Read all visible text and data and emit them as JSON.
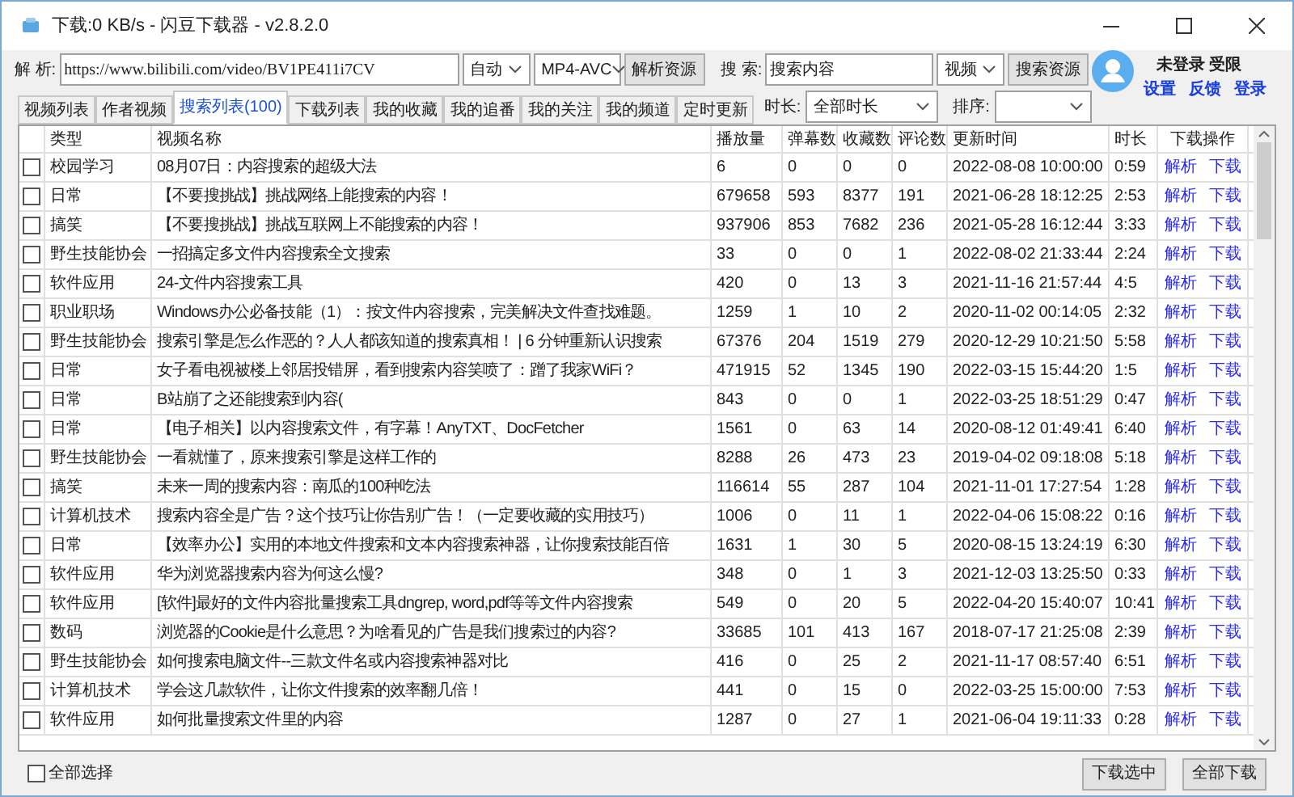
{
  "window": {
    "title": "下载:0 KB/s - 闪豆下载器 - v2.8.2.0"
  },
  "parse_bar": {
    "label": "解 析:",
    "url": "https://www.bilibili.com/video/BV1PE411i7CV",
    "mode": "自动",
    "format": "MP4-AVC",
    "button": "解析资源"
  },
  "search_bar": {
    "label": "搜 索:",
    "value": "搜索内容",
    "type": "视频",
    "button": "搜索资源"
  },
  "user": {
    "status": "未登录 受限",
    "links": [
      "设置",
      "反馈",
      "登录"
    ]
  },
  "tabs": [
    {
      "label": "视频列表",
      "selected": false
    },
    {
      "label": "作者视频",
      "selected": false
    },
    {
      "label": "搜索列表(100)",
      "selected": true
    },
    {
      "label": "下载列表",
      "selected": false
    },
    {
      "label": "我的收藏",
      "selected": false
    },
    {
      "label": "我的追番",
      "selected": false
    },
    {
      "label": "我的关注",
      "selected": false
    },
    {
      "label": "我的频道",
      "selected": false
    },
    {
      "label": "定时更新",
      "selected": false
    }
  ],
  "filters": {
    "duration_label": "时长:",
    "duration": "全部时长",
    "sort_label": "排序:"
  },
  "table": {
    "columns": [
      "类型",
      "视频名称",
      "播放量",
      "弹幕数",
      "收藏数",
      "评论数",
      "更新时间",
      "时长",
      "下载操作"
    ],
    "rows": [
      {
        "checked": false,
        "type": "校园学习",
        "name": "08月07日：内容搜索的超级大法",
        "plays": "6",
        "danmaku": "0",
        "favorites": "0",
        "comments": "0",
        "updated": "2022-08-08 10:00:00",
        "duration": "0:59",
        "actions": [
          "解析",
          "下载"
        ]
      },
      {
        "checked": false,
        "type": "日常",
        "name": "【不要搜挑战】挑战网络上能搜索的内容！",
        "plays": "679658",
        "danmaku": "593",
        "favorites": "8377",
        "comments": "191",
        "updated": "2021-06-28 18:12:25",
        "duration": "2:53",
        "actions": [
          "解析",
          "下载"
        ]
      },
      {
        "checked": false,
        "type": "搞笑",
        "name": "【不要搜挑战】挑战互联网上不能搜索的内容！",
        "plays": "937906",
        "danmaku": "853",
        "favorites": "7682",
        "comments": "236",
        "updated": "2021-05-28 16:12:44",
        "duration": "3:33",
        "actions": [
          "解析",
          "下载"
        ]
      },
      {
        "checked": false,
        "type": "野生技能协会",
        "name": "一招搞定多文件内容搜索全文搜索",
        "plays": "33",
        "danmaku": "0",
        "favorites": "0",
        "comments": "1",
        "updated": "2022-08-02 21:33:44",
        "duration": "2:24",
        "actions": [
          "解析",
          "下载"
        ]
      },
      {
        "checked": false,
        "type": "软件应用",
        "name": "24-文件内容搜索工具",
        "plays": "420",
        "danmaku": "0",
        "favorites": "13",
        "comments": "3",
        "updated": "2021-11-16 21:57:44",
        "duration": "4:5",
        "actions": [
          "解析",
          "下载"
        ]
      },
      {
        "checked": false,
        "type": "职业职场",
        "name": "Windows办公必备技能（1）：按文件内容搜索，完美解决文件查找难题。",
        "plays": "1259",
        "danmaku": "1",
        "favorites": "10",
        "comments": "2",
        "updated": "2020-11-02 00:14:05",
        "duration": "2:32",
        "actions": [
          "解析",
          "下载"
        ]
      },
      {
        "checked": false,
        "type": "野生技能协会",
        "name": "搜索引擎是怎么作恶的？人人都该知道的搜索真相！ | 6 分钟重新认识搜索",
        "plays": "67376",
        "danmaku": "204",
        "favorites": "1519",
        "comments": "279",
        "updated": "2020-12-29 10:21:50",
        "duration": "5:58",
        "actions": [
          "解析",
          "下载"
        ]
      },
      {
        "checked": false,
        "type": "日常",
        "name": "女子看电视被楼上邻居投错屏，看到搜索内容笑喷了：蹭了我家WiFi？",
        "plays": "471915",
        "danmaku": "52",
        "favorites": "1345",
        "comments": "190",
        "updated": "2022-03-15 15:44:20",
        "duration": "1:5",
        "actions": [
          "解析",
          "下载"
        ]
      },
      {
        "checked": false,
        "type": "日常",
        "name": "B站崩了之还能搜索到内容(",
        "plays": "843",
        "danmaku": "0",
        "favorites": "0",
        "comments": "1",
        "updated": "2022-03-25 18:51:29",
        "duration": "0:47",
        "actions": [
          "解析",
          "下载"
        ]
      },
      {
        "checked": false,
        "type": "日常",
        "name": "【电子相关】以内容搜索文件，有字幕！AnyTXT、DocFetcher",
        "plays": "1561",
        "danmaku": "0",
        "favorites": "63",
        "comments": "14",
        "updated": "2020-08-12 01:49:41",
        "duration": "6:40",
        "actions": [
          "解析",
          "下载"
        ]
      },
      {
        "checked": false,
        "type": "野生技能协会",
        "name": "一看就懂了，原来搜索引擎是这样工作的",
        "plays": "8288",
        "danmaku": "26",
        "favorites": "473",
        "comments": "23",
        "updated": "2019-04-02 09:18:08",
        "duration": "5:18",
        "actions": [
          "解析",
          "下载"
        ]
      },
      {
        "checked": false,
        "type": "搞笑",
        "name": "未来一周的搜索内容：南瓜的100种吃法",
        "plays": "116614",
        "danmaku": "55",
        "favorites": "287",
        "comments": "104",
        "updated": "2021-11-01 17:27:54",
        "duration": "1:28",
        "actions": [
          "解析",
          "下载"
        ]
      },
      {
        "checked": false,
        "type": "计算机技术",
        "name": "搜索内容全是广告？这个技巧让你告别广告！（一定要收藏的实用技巧）",
        "plays": "1006",
        "danmaku": "0",
        "favorites": "11",
        "comments": "1",
        "updated": "2022-04-06 15:08:22",
        "duration": "0:16",
        "actions": [
          "解析",
          "下载"
        ]
      },
      {
        "checked": false,
        "type": "日常",
        "name": "【效率办公】实用的本地文件搜索和文本内容搜索神器，让你搜索技能百倍",
        "plays": "1631",
        "danmaku": "1",
        "favorites": "30",
        "comments": "5",
        "updated": "2020-08-15 13:24:19",
        "duration": "6:30",
        "actions": [
          "解析",
          "下载"
        ]
      },
      {
        "checked": false,
        "type": "软件应用",
        "name": "华为浏览器搜索内容为何这么慢?",
        "plays": "348",
        "danmaku": "0",
        "favorites": "1",
        "comments": "3",
        "updated": "2021-12-03 13:25:50",
        "duration": "0:33",
        "actions": [
          "解析",
          "下载"
        ]
      },
      {
        "checked": false,
        "type": "软件应用",
        "name": "[软件]最好的文件内容批量搜索工具dngrep, word,pdf等等文件内容搜索",
        "plays": "549",
        "danmaku": "0",
        "favorites": "20",
        "comments": "5",
        "updated": "2022-04-20 15:40:07",
        "duration": "10:41",
        "actions": [
          "解析",
          "下载"
        ]
      },
      {
        "checked": false,
        "type": "数码",
        "name": "浏览器的Cookie是什么意思？为啥看见的广告是我们搜索过的内容?",
        "plays": "33685",
        "danmaku": "101",
        "favorites": "413",
        "comments": "167",
        "updated": "2018-07-17 21:25:08",
        "duration": "2:39",
        "actions": [
          "解析",
          "下载"
        ]
      },
      {
        "checked": false,
        "type": "野生技能协会",
        "name": "如何搜索电脑文件--三款文件名或内容搜索神器对比",
        "plays": "416",
        "danmaku": "0",
        "favorites": "25",
        "comments": "2",
        "updated": "2021-11-17 08:57:40",
        "duration": "6:51",
        "actions": [
          "解析",
          "下载"
        ]
      },
      {
        "checked": false,
        "type": "计算机技术",
        "name": "学会这几款软件，让你文件搜索的效率翻几倍！",
        "plays": "441",
        "danmaku": "0",
        "favorites": "15",
        "comments": "0",
        "updated": "2022-03-25 15:00:00",
        "duration": "7:53",
        "actions": [
          "解析",
          "下载"
        ]
      },
      {
        "checked": false,
        "type": "软件应用",
        "name": "如何批量搜索文件里的内容",
        "plays": "1287",
        "danmaku": "0",
        "favorites": "27",
        "comments": "1",
        "updated": "2021-06-04 19:11:33",
        "duration": "0:28",
        "actions": [
          "解析",
          "下载"
        ]
      }
    ]
  },
  "footer": {
    "select_all": {
      "label": "全部选择",
      "checked": false
    },
    "buttons": [
      "下载选中",
      "全部下载"
    ]
  }
}
